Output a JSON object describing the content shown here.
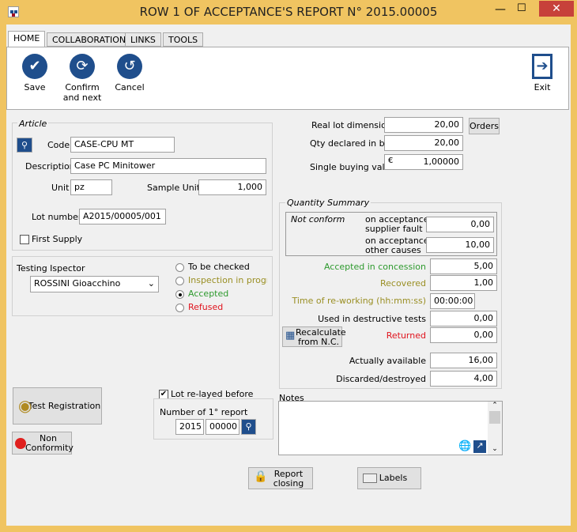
{
  "window": {
    "title": "ROW 1 OF ACCEPTANCE'S REPORT N° 2015.00005"
  },
  "tabs": [
    {
      "label": "HOME"
    },
    {
      "label": "COLLABORATION"
    },
    {
      "label": "LINKS"
    },
    {
      "label": "TOOLS"
    }
  ],
  "ribbon": {
    "save": "Save",
    "confirm1": "Confirm",
    "confirm2": "and next",
    "cancel": "Cancel",
    "exit": "Exit"
  },
  "article": {
    "legend": "Article",
    "code_label": "Code",
    "code": "CASE-CPU MT",
    "desc_label": "Description",
    "desc": "Case PC Minitower",
    "unit_label": "Unit",
    "unit": "pz",
    "sample_label": "Sample Unit",
    "sample": "1,000",
    "lot_label": "Lot number",
    "lot": "A2015/00005/001",
    "first_supply": "First Supply",
    "first_supply_checked": false
  },
  "lot": {
    "real_label": "Real lot dimension",
    "real": "20,00",
    "orders": "Orders",
    "qty_label": "Qty declared in bill",
    "qty": "20,00",
    "buy_label": "Single buying value",
    "currency": "€",
    "buy": "1,00000"
  },
  "testing": {
    "label": "Testing Ispector",
    "inspector": "ROSSINI Gioacchino",
    "options": [
      "To be checked",
      "Inspection in progr",
      "Accepted",
      "Refused"
    ],
    "selected": "Accepted"
  },
  "summary": {
    "legend": "Quantity Summary",
    "not_conform": "Not conform",
    "supplier1": "on acceptance",
    "supplier2": "supplier fault",
    "supplier": "0,00",
    "other1": "on acceptance",
    "other2": "other causes",
    "other": "10,00",
    "concession_label": "Accepted in concession",
    "concession": "5,00",
    "recovered_label": "Recovered",
    "recovered": "1,00",
    "time_label": "Time of re-working (hh:mm:ss)",
    "time": "00:00:00",
    "destr_label": "Used in destructive tests",
    "destr": "0,00",
    "recalc1": "Recalculate",
    "recalc2": "from N.C.",
    "returned_label": "Returned",
    "returned": "0,00",
    "avail_label": "Actually available",
    "avail": "16,00",
    "disc_label": "Discarded/destroyed",
    "disc": "4,00"
  },
  "bottom": {
    "test_reg": "Test Registration",
    "nc1": "Non",
    "nc2": "Conformity",
    "relayed": "Lot re-layed before",
    "relayed_checked": true,
    "num_label": "Number of 1° report",
    "year": "2015",
    "num": "00000",
    "notes_label": "Notes",
    "notes": "",
    "closing1": "Report",
    "closing2": "closing",
    "labels": "Labels"
  }
}
